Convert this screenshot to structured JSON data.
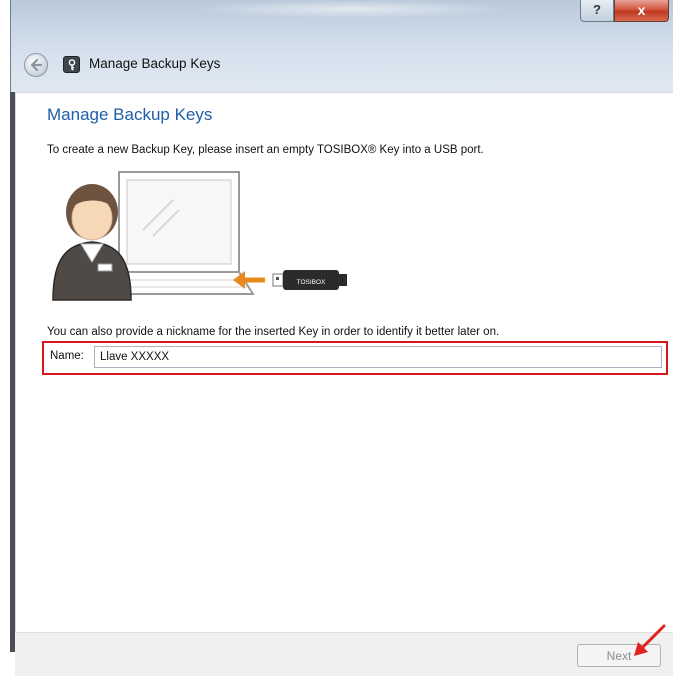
{
  "window": {
    "title": "Manage Backup Keys",
    "help_label": "?",
    "close_label": "x"
  },
  "page": {
    "heading": "Manage Backup Keys",
    "instruction": "To create a new Backup Key, please insert an empty TOSIBOX® Key into a USB port.",
    "nickname_hint": "You can also provide a nickname for the inserted Key in order to identify it better later on."
  },
  "illustration": {
    "usb_label": "TOSIBOX"
  },
  "form": {
    "name_label": "Name:",
    "name_value": "Llave XXXXX"
  },
  "footer": {
    "next_label": "Next"
  },
  "colors": {
    "heading": "#1f5ea8",
    "highlight": "#d8141c",
    "usb_arrow": "#e8891c"
  }
}
